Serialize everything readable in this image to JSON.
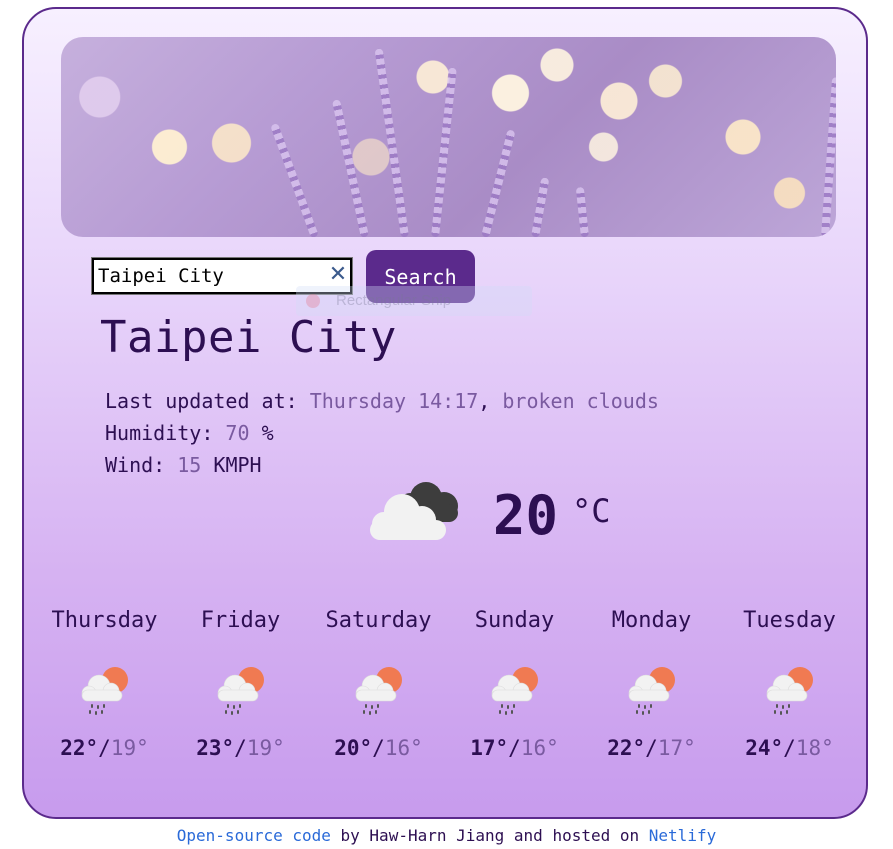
{
  "search": {
    "value": "Taipei City",
    "clear_icon": "close-icon",
    "button_label": "Search"
  },
  "overlay": {
    "label": "Rectangular Snip"
  },
  "current": {
    "city": "Taipei City",
    "last_updated_label": "Last updated at:",
    "last_updated_value": "Thursday 14:17",
    "separator": ",",
    "description": "broken clouds",
    "humidity_label": "Humidity:",
    "humidity_value": "70",
    "humidity_unit": "%",
    "wind_label": "Wind:",
    "wind_value": "15",
    "wind_unit": "KMPH",
    "icon": "broken-clouds-icon",
    "temperature": "20",
    "unit": "°C"
  },
  "forecast": [
    {
      "day": "Thursday",
      "icon": "rain-sun-icon",
      "hi": "22°",
      "lo": "19°"
    },
    {
      "day": "Friday",
      "icon": "rain-sun-icon",
      "hi": "23°",
      "lo": "19°"
    },
    {
      "day": "Saturday",
      "icon": "rain-sun-icon",
      "hi": "20°",
      "lo": "16°"
    },
    {
      "day": "Sunday",
      "icon": "rain-sun-icon",
      "hi": "17°",
      "lo": "16°"
    },
    {
      "day": "Monday",
      "icon": "rain-sun-icon",
      "hi": "22°",
      "lo": "17°"
    },
    {
      "day": "Tuesday",
      "icon": "rain-sun-icon",
      "hi": "24°",
      "lo": "18°"
    }
  ],
  "footer": {
    "source_link": "Open-source code",
    "text_by": " by Haw-Harn Jiang and hosted on ",
    "host_link": "Netlify"
  },
  "colors": {
    "accent": "#5b2a8c",
    "text": "#2d0f52",
    "muted": "#7a5aa0",
    "link": "#2a6ad8"
  }
}
